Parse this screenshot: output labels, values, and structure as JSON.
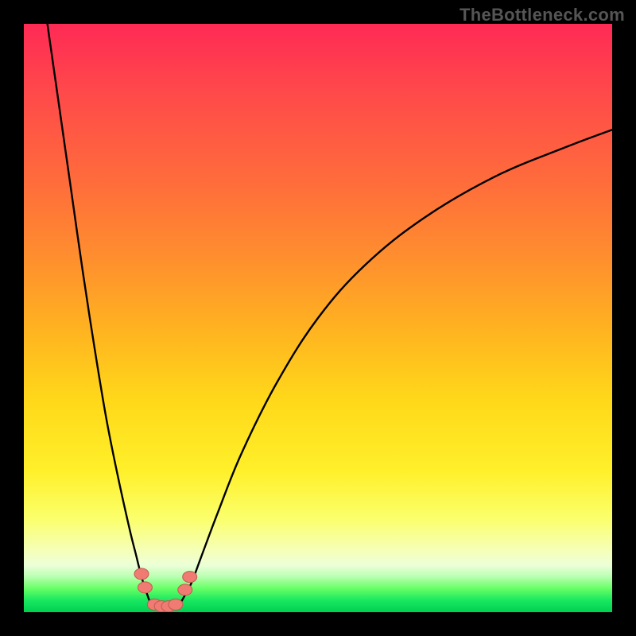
{
  "watermark": "TheBottleneck.com",
  "chart_data": {
    "type": "line",
    "title": "",
    "xlabel": "",
    "ylabel": "",
    "xlim": [
      0,
      100
    ],
    "ylim": [
      0,
      100
    ],
    "series": [
      {
        "name": "left-branch",
        "x": [
          4,
          6,
          8,
          10,
          12,
          14,
          16,
          18,
          19,
          20,
          20.8,
          21.4,
          22
        ],
        "y": [
          100,
          86,
          72,
          58,
          45,
          33,
          23,
          14,
          10,
          6,
          3.5,
          1.8,
          0.5
        ]
      },
      {
        "name": "right-branch",
        "x": [
          26,
          27,
          28.5,
          30,
          33,
          37,
          43,
          50,
          58,
          68,
          80,
          92,
          100
        ],
        "y": [
          0.5,
          2.2,
          5,
          9,
          17,
          27,
          39,
          50,
          59,
          67,
          74,
          79,
          82
        ]
      }
    ],
    "markers": [
      {
        "name": "left-marker-upper",
        "x": 20.0,
        "y": 6.5
      },
      {
        "name": "left-marker-lower",
        "x": 20.6,
        "y": 4.2
      },
      {
        "name": "bottom-marker-1",
        "x": 22.2,
        "y": 1.3
      },
      {
        "name": "bottom-marker-2",
        "x": 23.4,
        "y": 1.0
      },
      {
        "name": "bottom-marker-3",
        "x": 24.6,
        "y": 1.0
      },
      {
        "name": "bottom-marker-4",
        "x": 25.8,
        "y": 1.3
      },
      {
        "name": "right-marker-lower",
        "x": 27.4,
        "y": 3.8
      },
      {
        "name": "right-marker-upper",
        "x": 28.2,
        "y": 6.0
      }
    ],
    "background_gradient": {
      "top": "#ff2a55",
      "mid": "#ffe627",
      "bottom": "#00d050"
    }
  }
}
